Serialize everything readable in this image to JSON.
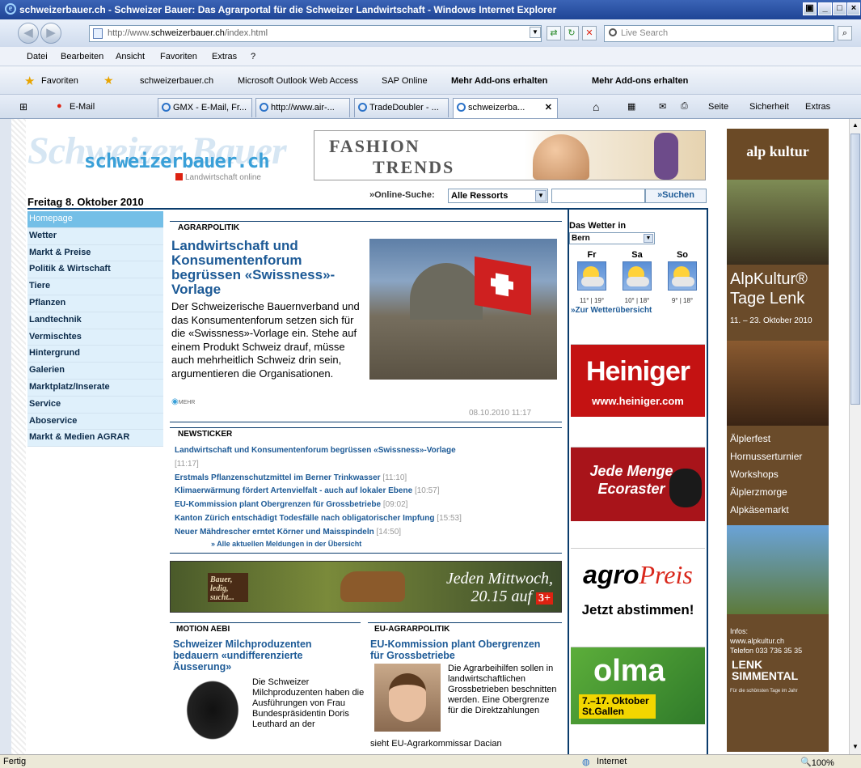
{
  "window": {
    "title": "schweizerbauer.ch - Schweizer Bauer: Das Agrarportal für die Schweizer Landwirtschaft - Windows Internet Explorer"
  },
  "address": {
    "url_prefix": "http://www.",
    "url_domain": "schweizerbauer.ch",
    "url_path": "/index.html"
  },
  "search": {
    "placeholder": "Live Search"
  },
  "menu": [
    "Datei",
    "Bearbeiten",
    "Ansicht",
    "Favoriten",
    "Extras",
    "?"
  ],
  "favorites": {
    "label": "Favoriten",
    "items": [
      "schweizerbauer.ch",
      "Microsoft Outlook Web Access",
      "SAP Online",
      "Mehr Add-ons erhalten",
      "Mehr Add-ons erhalten"
    ]
  },
  "tabs": {
    "email": "E-Mail",
    "items": [
      "GMX - E-Mail, Fr...",
      "http://www.air-...",
      "TradeDoubler - ...",
      "schweizerba..."
    ]
  },
  "commandbar": {
    "seite": "Seite",
    "sicherheit": "Sicherheit",
    "extras": "Extras"
  },
  "status": {
    "left": "Fertig",
    "zone": "Internet",
    "zoom": "100%"
  },
  "site": {
    "logo_bg": "Schweizer Bauer",
    "logo": "schweizerbauer.ch",
    "logo_sub": "Landwirtschaft online",
    "date": "Freitag 8. Oktober 2010",
    "fashion": {
      "line1": "FASHION",
      "line2": "TRENDS"
    },
    "online_search_label": "»Online-Suche:",
    "online_search_select": "Alle Ressorts",
    "online_search_button": "»Suchen",
    "nav": [
      "Homepage",
      "Wetter",
      "Markt & Preise",
      "Politik & Wirtschaft",
      "Tiere",
      "Pflanzen",
      "Landtechnik",
      "Vermischtes",
      "Hintergrund",
      "Galerien",
      "Marktplatz/Inserate",
      "Service",
      "Aboservice",
      "Markt & Medien AGRAR"
    ],
    "lead": {
      "section": "AGRARPOLITIK",
      "title": "Landwirtschaft und Konsumentenforum begrüssen «Swissness»-Vorlage",
      "text": "Der Schweizerische Bauernverband und das Konsumentenforum setzen sich für die «Swissness»-Vorlage ein. Stehe auf einem Produkt Schweiz drauf, müsse auch mehrheitlich Schweiz drin sein, argumentieren die Organisationen.",
      "more": "MEHR",
      "timestamp": "08.10.2010 11:17"
    },
    "newsticker": {
      "section": "NEWSTICKER",
      "items": [
        {
          "text": "Landwirtschaft und Konsumentenforum begrüssen «Swissness»-Vorlage",
          "time": "[11:17]"
        },
        {
          "text": "Erstmals Pflanzenschutzmittel im Berner Trinkwasser",
          "time": "[11:10]"
        },
        {
          "text": "Klimaerwärmung fördert Artenvielfalt - auch auf lokaler Ebene",
          "time": "[10:57]"
        },
        {
          "text": "EU-Kommission plant Obergrenzen für Grossbetriebe",
          "time": "[09:02]"
        },
        {
          "text": "Kanton Zürich entschädigt Todesfälle nach obligatorischer Impfung",
          "time": "[15:53]"
        },
        {
          "text": "Neuer Mähdrescher erntet Körner und Maisspindeln",
          "time": "[14:50]"
        }
      ],
      "more": "» Alle aktuellen Meldungen in der Übersicht"
    },
    "tv_ad": {
      "sign": "Bauer, ledig, sucht...",
      "text": "Jeden Mittwoch, 20.15 auf",
      "channel": "3+"
    },
    "motion": {
      "section": "MOTION AEBI",
      "title": "Schweizer Milchproduzenten bedauern «undifferenzierte Äusserung»",
      "text": "Die Schweizer Milchproduzenten haben die Ausführungen von Frau Bundespräsidentin Doris Leuthard an der"
    },
    "eu": {
      "section": "EU-AGRARPOLITIK",
      "title": "EU-Kommission plant Obergrenzen für Grossbetriebe",
      "text": "Die Agrarbeihilfen sollen in landwirtschaftlichen Grossbetrieben beschnitten werden. Eine Obergrenze für die Direktzahlungen",
      "text2": "sieht EU-Agrarkommissar Dacian"
    },
    "weather": {
      "title": "Das Wetter in",
      "city": "Bern",
      "days": [
        {
          "d": "Fr",
          "t": "11° | 19°"
        },
        {
          "d": "Sa",
          "t": "10° | 18°"
        },
        {
          "d": "So",
          "t": "9° | 18°"
        }
      ],
      "more": "»Zur Wetterübersicht"
    },
    "ads": {
      "heiniger": "Heiniger",
      "heiniger_url": "www.heiniger.com",
      "ecoraster": "Jede Menge Ecoraster",
      "agro1": "agro",
      "agro2": "Preis",
      "agro_cta": "Jetzt abstimmen!",
      "olma": "olma",
      "olma_date": "7.–17. Oktober",
      "olma_city": "St.Gallen"
    },
    "alpkultur": {
      "head": "alp kultur",
      "title1": "AlpKultur®",
      "title2": "Tage Lenk",
      "dates": "11. – 23. Oktober 2010",
      "items": [
        "Älplerfest",
        "Hornusserturnier",
        "Workshops",
        "Älplerzmorge",
        "Alpkäsemarkt"
      ],
      "info1": "Infos:",
      "info2": "www.alpkultur.ch",
      "info3": "Telefon 033 736 35 35",
      "lenk1": "LENK",
      "lenk2": "SIMMENTAL",
      "slogan": "Für die schönsten Tage im Jahr"
    }
  }
}
